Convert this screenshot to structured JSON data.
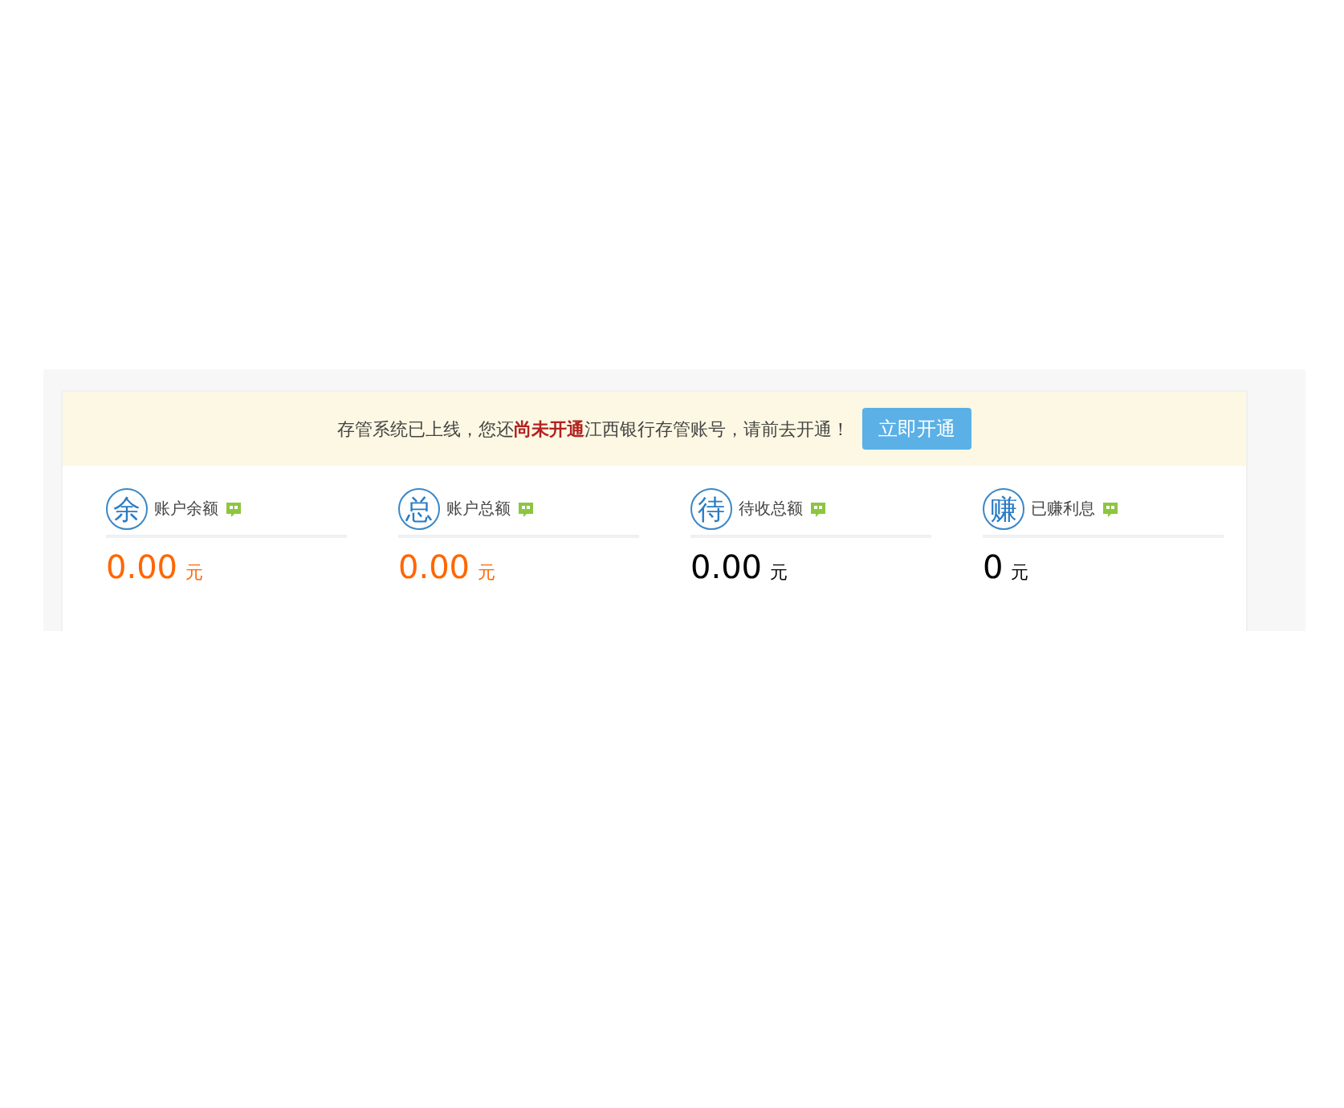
{
  "notice": {
    "text": "存管系统已上线，您还**尚未开通**江西银行存管账号，请前去开通！",
    "button": "立即开通"
  },
  "stats": [
    {
      "badge": "余",
      "label": "账户余额",
      "value": "0.00",
      "unit": "元",
      "color": "#ff6600"
    },
    {
      "badge": "总",
      "label": "账户总额",
      "value": "0.00",
      "unit": "元",
      "color": "#ff6600"
    },
    {
      "badge": "待",
      "label": "待收总额",
      "value": "0.00",
      "unit": "元",
      "color": "#000000"
    },
    {
      "badge": "赚",
      "label": "已赚利息",
      "value": "0",
      "unit": "元",
      "color": "#000000"
    }
  ]
}
